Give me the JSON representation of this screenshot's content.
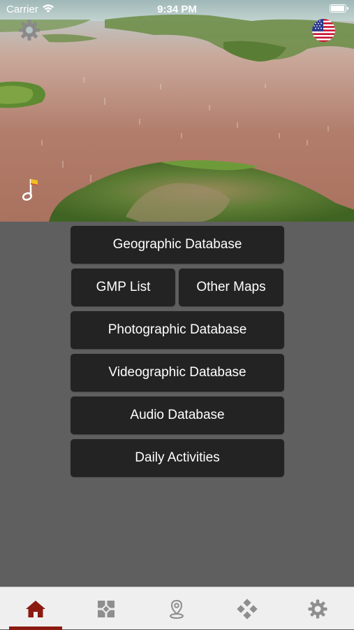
{
  "status_bar": {
    "carrier": "Carrier",
    "time": "9:34 PM",
    "battery_level": 1.0
  },
  "header": {
    "settings_icon": "gear-icon",
    "language_icon": "us-flag-icon",
    "music_icon": "music-note-icon"
  },
  "menu": {
    "geographic": "Geographic Database",
    "gmp_list": "GMP List",
    "other_maps": "Other Maps",
    "photographic": "Photographic Database",
    "videographic": "Videographic Database",
    "audio": "Audio Database",
    "daily": "Daily Activities"
  },
  "tab_bar": {
    "tabs": [
      {
        "icon": "home-icon",
        "active": true
      },
      {
        "icon": "grid-icon",
        "active": false
      },
      {
        "icon": "location-pin-icon",
        "active": false
      },
      {
        "icon": "diamond-grid-icon",
        "active": false
      },
      {
        "icon": "gear-icon",
        "active": false
      }
    ],
    "active_color": "#8b1a10",
    "inactive_color": "#8e8e8e"
  }
}
